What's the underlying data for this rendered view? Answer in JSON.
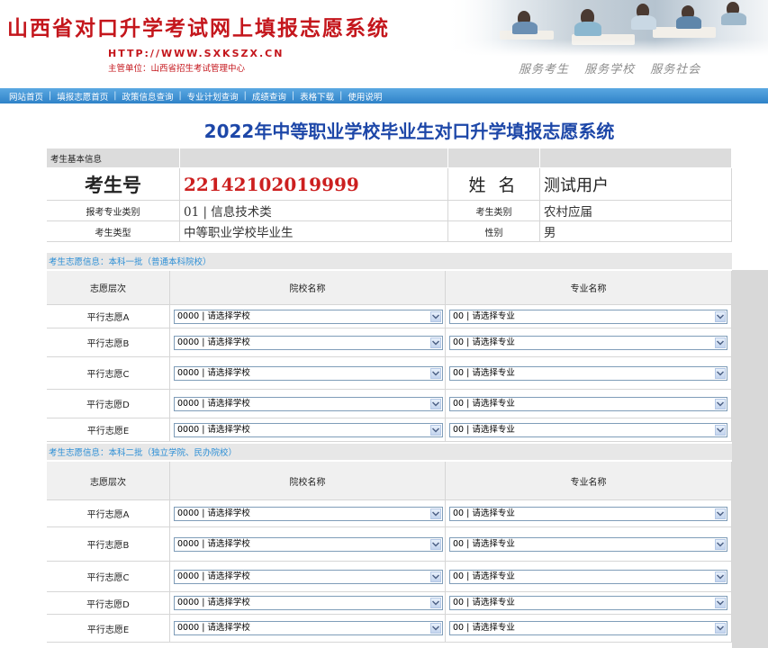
{
  "header": {
    "title": "山西省对口升学考试网上填报志愿系统",
    "url": "HTTP://WWW.SXKSZX.CN",
    "org": "主管单位：山西省招生考试管理中心",
    "slogan": "服务考生  服务学校  服务社会"
  },
  "nav": {
    "items": [
      "网站首页",
      "填报志愿首页",
      "政策信息查询",
      "专业计划查询",
      "成绩查询",
      "表格下载",
      "使用说明"
    ]
  },
  "page_title": "2022年中等职业学校毕业生对口升学填报志愿系统",
  "basic_info": {
    "section_label": "考生基本信息",
    "exam_no_label": "考生号",
    "exam_no": "22142102019999",
    "name_label": "姓 名",
    "name": "测试用户",
    "major_category_label": "报考专业类别",
    "major_category": "01 | 信息技术类",
    "student_category_label": "考生类别",
    "student_category": "农村应届",
    "student_type_label": "考生类型",
    "student_type": "中等职业学校毕业生",
    "gender_label": "性别",
    "gender": "男"
  },
  "batch1": {
    "section_label": "考生志愿信息：本科一批（普通本科院校）",
    "col_level": "志愿层次",
    "col_school": "院校名称",
    "col_major": "专业名称",
    "rows": [
      {
        "label": "平行志愿A",
        "school": "0000 | 请选择学校",
        "major": "00 | 请选择专业"
      },
      {
        "label": "平行志愿B",
        "school": "0000 | 请选择学校",
        "major": "00 | 请选择专业"
      },
      {
        "label": "平行志愿C",
        "school": "0000 | 请选择学校",
        "major": "00 | 请选择专业"
      },
      {
        "label": "平行志愿D",
        "school": "0000 | 请选择学校",
        "major": "00 | 请选择专业"
      },
      {
        "label": "平行志愿E",
        "school": "0000 | 请选择学校",
        "major": "00 | 请选择专业"
      }
    ]
  },
  "batch2": {
    "section_label": "考生志愿信息：本科二批（独立学院、民办院校）",
    "col_level": "志愿层次",
    "col_school": "院校名称",
    "col_major": "专业名称",
    "rows": [
      {
        "label": "平行志愿A",
        "school": "0000 | 请选择学校",
        "major": "00 | 请选择专业"
      },
      {
        "label": "平行志愿B",
        "school": "0000 | 请选择学校",
        "major": "00 | 请选择专业"
      },
      {
        "label": "平行志愿C",
        "school": "0000 | 请选择学校",
        "major": "00 | 请选择专业"
      },
      {
        "label": "平行志愿D",
        "school": "0000 | 请选择学校",
        "major": "00 | 请选择专业"
      },
      {
        "label": "平行志愿E",
        "school": "0000 | 请选择学校",
        "major": "00 | 请选择专业"
      }
    ]
  },
  "colors": {
    "brand_red": "#c4161c",
    "nav_blue": "#2f82c8",
    "title_blue": "#1d47a8",
    "section_text": "#2d8fd6"
  },
  "icons": {
    "select_arrow": "chevron-down-icon",
    "header_photo": "exam-room-photo"
  }
}
